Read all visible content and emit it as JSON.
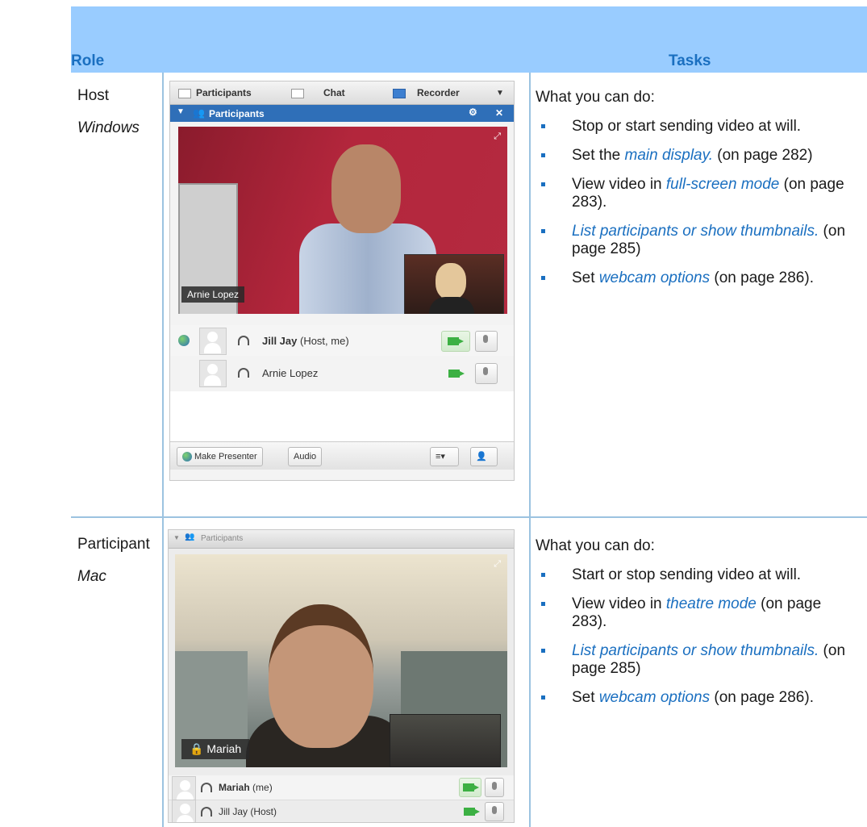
{
  "table": {
    "header_role": "Role",
    "header_tasks": "Tasks",
    "rows": [
      {
        "role": "Host",
        "os": "Windows",
        "intro": "What you can do:",
        "tasks": [
          {
            "pre": "Stop or start sending video at will.",
            "link": "",
            "post": ""
          },
          {
            "pre": "Set the ",
            "link": "main display.",
            "post": " (on page 282)"
          },
          {
            "pre": "View video in ",
            "link": "full-screen mode",
            "post": " (on page 283)."
          },
          {
            "pre": "",
            "link": "List participants or show thumbnails.",
            "post": " (on page 285)"
          },
          {
            "pre": "Set ",
            "link": "webcam options",
            "post": " (on page 286)."
          }
        ]
      },
      {
        "role": "Participant",
        "os": "Mac",
        "intro": "What you can do:",
        "tasks": [
          {
            "pre": "Start or stop sending video at will.",
            "link": "",
            "post": ""
          },
          {
            "pre": "View video in ",
            "link": "theatre mode",
            "post": " (on page 283)."
          },
          {
            "pre": "",
            "link": "List participants or show thumbnails.",
            "post": " (on page 285)"
          },
          {
            "pre": "Set ",
            "link": "webcam options",
            "post": " (on page 286)."
          }
        ]
      }
    ]
  },
  "win_panel": {
    "tabs": [
      "Participants",
      "Chat",
      "Recorder"
    ],
    "panel_title": "Participants",
    "video_name": "Arnie Lopez",
    "participants": [
      {
        "name": "Jill Jay",
        "note": " (Host, me)"
      },
      {
        "name": "Arnie Lopez",
        "note": ""
      }
    ],
    "make_presenter": "Make Presenter",
    "audio": "Audio"
  },
  "mac_panel": {
    "panel_title": "Participants",
    "video_name": "Mariah",
    "participants": [
      {
        "name": "Mariah",
        "note": " (me)"
      },
      {
        "name": "Jill Jay (Host)",
        "note": ""
      }
    ]
  },
  "colors": {
    "accent": "#1a6fc0",
    "header_bg": "#99ccff",
    "rule": "#9cc3e0"
  }
}
